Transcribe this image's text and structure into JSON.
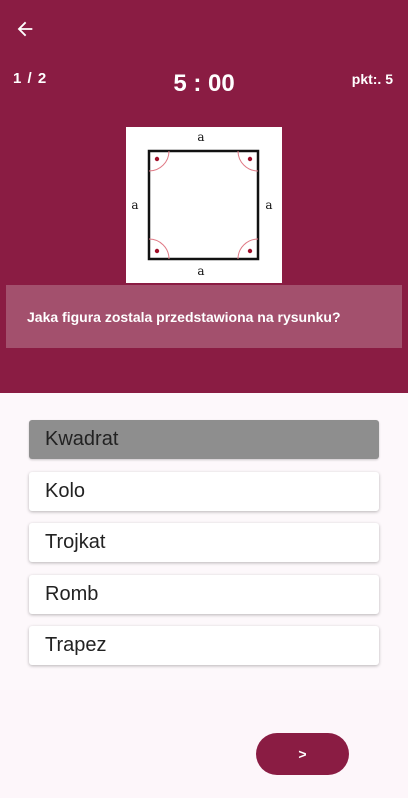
{
  "header": {
    "back_icon": "arrow-left-icon",
    "counter": "1 / 2",
    "timer": "5 : 00",
    "points": "pkt:. 5"
  },
  "figure": {
    "side_label_top": "a",
    "side_label_bottom": "a",
    "side_label_left": "a",
    "side_label_right": "a"
  },
  "question": {
    "text": "Jaka figura zostala przedstawiona na rysunku?"
  },
  "answers": [
    {
      "label": "Kwadrat",
      "selected": true
    },
    {
      "label": "Kolo",
      "selected": false
    },
    {
      "label": "Trojkat",
      "selected": false
    },
    {
      "label": "Romb",
      "selected": false
    },
    {
      "label": "Trapez",
      "selected": false
    }
  ],
  "next_button": {
    "label": ">"
  },
  "colors": {
    "primary": "#8a1c43",
    "question_bg": "#a3506d",
    "selected_answer": "#8e8e8e",
    "angle_mark": "#c8102e"
  }
}
